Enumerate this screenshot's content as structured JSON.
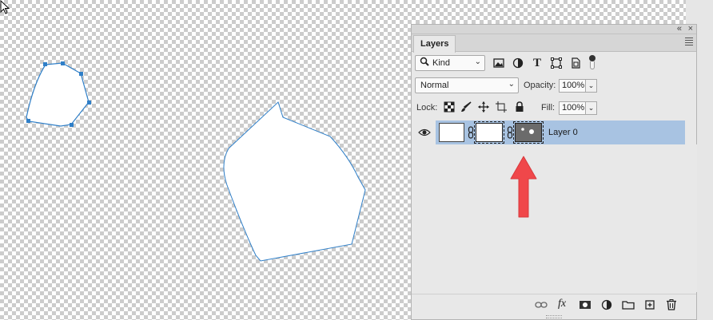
{
  "panel": {
    "tab_label": "Layers",
    "collapse_glyph": "«",
    "close_glyph": "×",
    "filter": {
      "kind_label": "Kind",
      "icons": [
        "image-filter-icon",
        "adjustment-filter-icon",
        "type-filter-icon",
        "shape-filter-icon",
        "smart-object-filter-icon",
        "filter-toggle"
      ],
      "type_glyph": "T"
    },
    "blend": {
      "mode": "Normal",
      "opacity_label": "Opacity:",
      "opacity_value": "100%"
    },
    "lock": {
      "label": "Lock:",
      "fill_label": "Fill:",
      "fill_value": "100%"
    },
    "layers": [
      {
        "name": "Layer 0",
        "visible": true,
        "selected": true,
        "selection_color": "#a8c3e2"
      }
    ],
    "footer_icons": [
      "link-layers-icon",
      "fx-icon",
      "add-mask-icon",
      "adjustment-layer-icon",
      "new-group-icon",
      "new-layer-icon",
      "delete-icon"
    ],
    "fx_label": "fx"
  },
  "annotation": {
    "arrow_color": "#f0474a"
  },
  "canvas": {
    "shape_outline_color": "#2f7fc8",
    "anchor_color": "#2f7fc8"
  }
}
